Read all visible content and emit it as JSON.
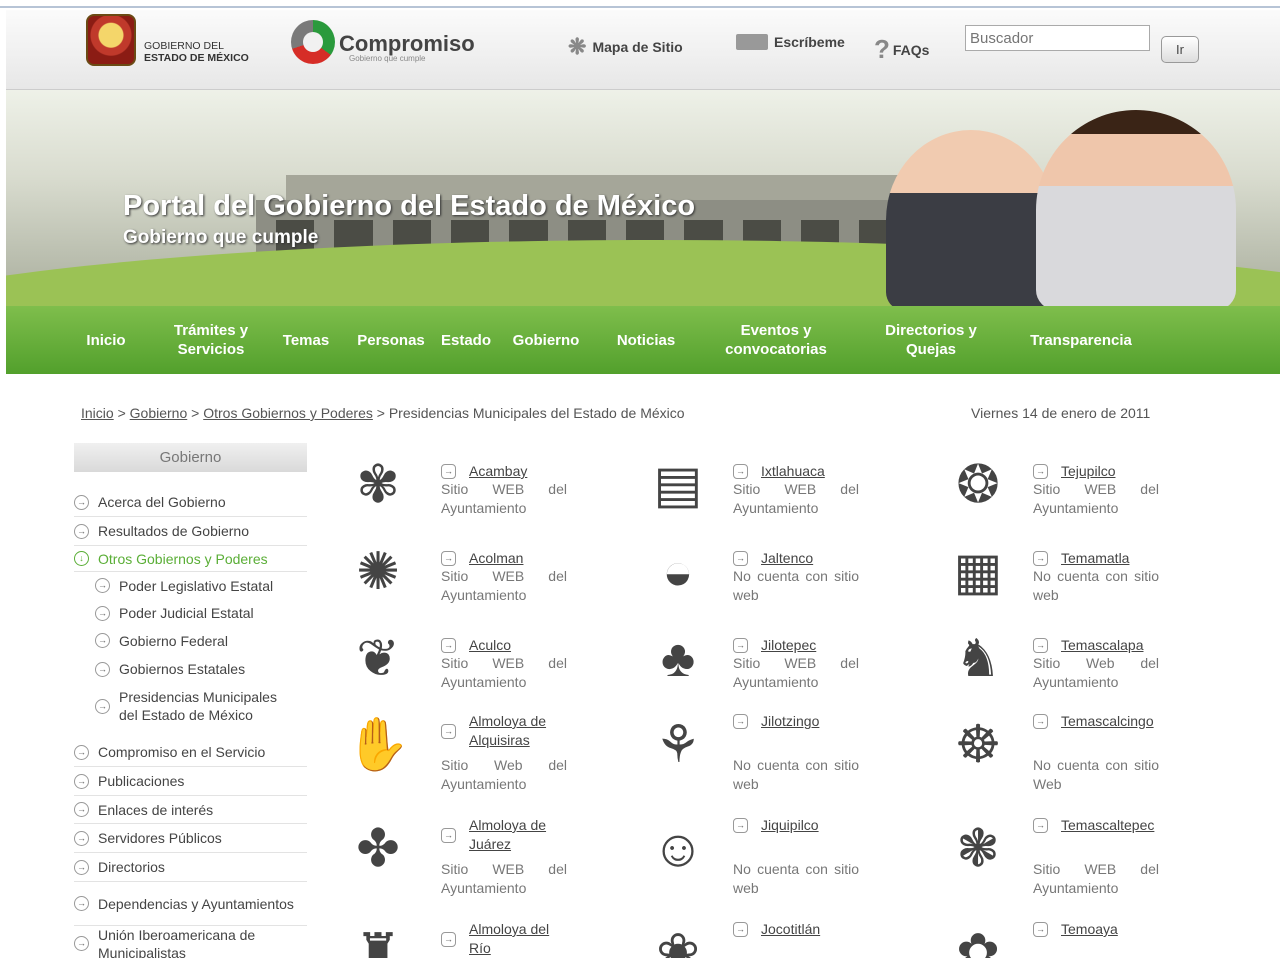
{
  "header": {
    "gov_line1": "GOBIERNO DEL",
    "gov_line2": "ESTADO DE MÉXICO",
    "logo_text": "Compromiso",
    "logo_sub": "Gobierno que cumple",
    "links": [
      "Mapa de Sitio",
      "Escríbeme",
      "FAQs"
    ],
    "search_placeholder": "Buscador",
    "search_button": "Ir"
  },
  "banner": {
    "title": "Portal del Gobierno del Estado de México",
    "subtitle": "Gobierno que cumple"
  },
  "nav": [
    [
      "Inicio"
    ],
    [
      "Trámites y",
      "Servicios"
    ],
    [
      "Temas"
    ],
    [
      "Personas"
    ],
    [
      "Estado"
    ],
    [
      "Gobierno"
    ],
    [
      "Noticias"
    ],
    [
      "Eventos y",
      "convocatorias"
    ],
    [
      "Directorios y",
      "Quejas"
    ],
    [
      "Transparencia"
    ]
  ],
  "breadcrumb": {
    "links": [
      "Inicio",
      "Gobierno",
      "Otros Gobiernos y Poderes"
    ],
    "current": "Presidencias Municipales del Estado de México",
    "separator": ">"
  },
  "date": "Viernes 14 de enero de 2011",
  "sidebar": {
    "title": "Gobierno",
    "items": [
      {
        "label": "Acerca del Gobierno"
      },
      {
        "label": "Resultados de Gobierno"
      },
      {
        "label": "Otros Gobiernos y Poderes",
        "active": true
      },
      {
        "label": "Poder Legislativo Estatal",
        "sub": true
      },
      {
        "label": "Poder Judicial Estatal",
        "sub": true
      },
      {
        "label": "Gobierno Federal",
        "sub": true
      },
      {
        "label": "Gobiernos Estatales",
        "sub": true
      },
      {
        "label": "Presidencias Municipales del Estado de México",
        "sub": true
      },
      {
        "label": "Compromiso en el Servicio"
      },
      {
        "label": "Publicaciones"
      },
      {
        "label": "Enlaces de interés"
      },
      {
        "label": "Servidores Públicos"
      },
      {
        "label": "Directorios"
      },
      {
        "label": "Dependencias y Ayuntamientos"
      },
      {
        "label": "Unión Iberoamericana de Municipalistas"
      }
    ]
  },
  "municipios": [
    [
      {
        "name": "Acambay",
        "text": "Sitio WEB del Ayuntamiento",
        "glyph": "✾"
      },
      {
        "name": "Acolman",
        "text": "Sitio WEB del Ayuntamiento",
        "glyph": "✺"
      },
      {
        "name": "Aculco",
        "text": "Sitio WEB del Ayuntamiento",
        "glyph": "❦"
      },
      {
        "name": "Almoloya de Alquisiras",
        "text": "Sitio Web del Ayuntamiento",
        "glyph": "✋"
      },
      {
        "name": "Almoloya de Juárez",
        "text": "Sitio WEB del Ayuntamiento",
        "glyph": "✤"
      },
      {
        "name": "Almoloya del Río",
        "text": "",
        "glyph": "♜"
      }
    ],
    [
      {
        "name": "Ixtlahuaca",
        "text": "Sitio WEB del Ayuntamiento",
        "glyph": "▤"
      },
      {
        "name": "Jaltenco",
        "text": "No cuenta con sitio web",
        "glyph": "◒"
      },
      {
        "name": "Jilotepec",
        "text": "Sitio WEB del Ayuntamiento",
        "glyph": "♣"
      },
      {
        "name": "Jilotzingo",
        "text": "No cuenta con sitio web",
        "glyph": "⚘"
      },
      {
        "name": "Jiquipilco",
        "text": "No cuenta con sitio web",
        "glyph": "☺"
      },
      {
        "name": "Jocotitlán",
        "text": "",
        "glyph": "❀"
      }
    ],
    [
      {
        "name": "Tejupilco",
        "text": "Sitio WEB del Ayuntamiento",
        "glyph": "❂"
      },
      {
        "name": "Temamatla",
        "text": "No cuenta con sitio web",
        "glyph": "▦"
      },
      {
        "name": "Temascalapa",
        "text": "Sitio Web del Ayuntamiento",
        "glyph": "♞"
      },
      {
        "name": "Temascalcingo",
        "text": "No cuenta con sitio Web",
        "glyph": "☸"
      },
      {
        "name": "Temascaltepec",
        "text": "Sitio WEB del Ayuntamiento",
        "glyph": "❃"
      },
      {
        "name": "Temoaya",
        "text": "",
        "glyph": "✿"
      }
    ]
  ],
  "colors": {
    "nav_green": "#5aa733",
    "active_green": "#5aae36",
    "text_gray": "#555555"
  }
}
